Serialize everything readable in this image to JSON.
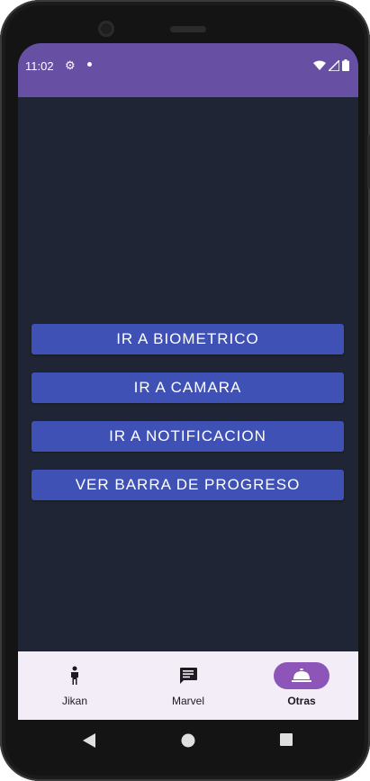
{
  "status_bar": {
    "time": "11:02",
    "gear_icon": "gear-icon",
    "color": "#6750a4"
  },
  "buttons": [
    {
      "label": "IR A BIOMETRICO"
    },
    {
      "label": "IR A CAMARA"
    },
    {
      "label": "IR A NOTIFICACION"
    },
    {
      "label": "VER BARRA DE PROGRESO"
    }
  ],
  "bottom_nav": {
    "items": [
      {
        "label": "Jikan",
        "icon": "person-icon",
        "active": false
      },
      {
        "label": "Marvel",
        "icon": "message-icon",
        "active": false
      },
      {
        "label": "Otras",
        "icon": "room-service-icon",
        "active": true
      }
    ],
    "active_color": "#8e55b8"
  },
  "theme": {
    "content_bg": "#1f2535",
    "button_bg": "#3f51b5"
  }
}
